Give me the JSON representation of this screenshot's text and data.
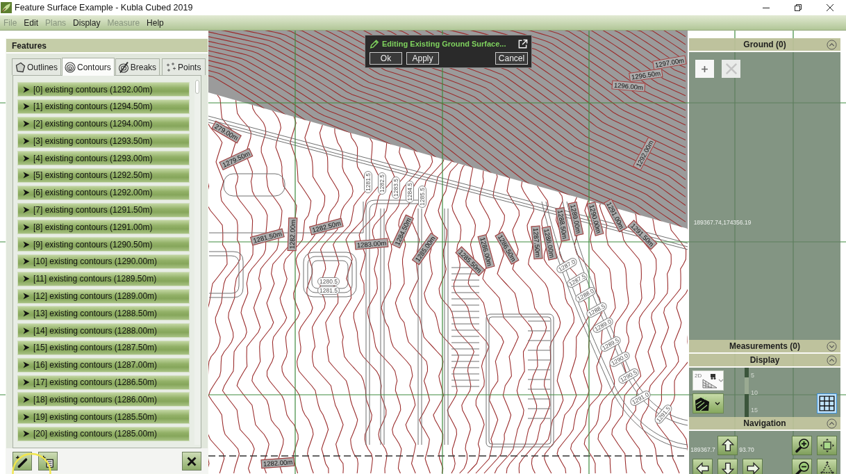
{
  "window": {
    "title": "Feature Surface Example - Kubla Cubed 2019"
  },
  "menu": [
    {
      "label": "File",
      "disabled": true
    },
    {
      "label": "Edit",
      "disabled": false
    },
    {
      "label": "Plans",
      "disabled": true
    },
    {
      "label": "Display",
      "disabled": false
    },
    {
      "label": "Measure",
      "disabled": true
    },
    {
      "label": "Help",
      "disabled": false
    }
  ],
  "features_panel": {
    "title": "Features",
    "tabs": [
      {
        "label": "Outlines",
        "kind": "outlines",
        "selected": false
      },
      {
        "label": "Contours",
        "kind": "contours",
        "selected": true
      },
      {
        "label": "Breaks",
        "kind": "breaks",
        "selected": false
      },
      {
        "label": "Points",
        "kind": "points",
        "selected": false
      }
    ],
    "items": [
      {
        "label": "[0] existing contours (1292.00m)",
        "expanded": false
      },
      {
        "label": "[1] existing contours (1294.50m)",
        "expanded": false
      },
      {
        "label": "[2] existing contours (1294.00m)",
        "expanded": false
      },
      {
        "label": "[3] existing contours (1293.50m)",
        "expanded": false
      },
      {
        "label": "[4] existing contours (1293.00m)",
        "expanded": false
      },
      {
        "label": "[5] existing contours (1292.50m)",
        "expanded": false
      },
      {
        "label": "[6] existing contours (1292.00m)",
        "expanded": false
      },
      {
        "label": "[7] existing contours (1291.50m)",
        "expanded": false
      },
      {
        "label": "[8] existing contours (1291.00m)",
        "expanded": false
      },
      {
        "label": "[9] existing contours (1290.50m)",
        "expanded": false
      },
      {
        "label": "[10] existing contours (1290.00m)",
        "expanded": false
      },
      {
        "label": "[11] existing contours (1289.50m)",
        "expanded": false
      },
      {
        "label": "[12] existing contours (1289.00m)",
        "expanded": false
      },
      {
        "label": "[13] existing contours (1288.50m)",
        "expanded": false
      },
      {
        "label": "[14] existing contours (1288.00m)",
        "expanded": false
      },
      {
        "label": "[15] existing contours (1287.50m)",
        "expanded": false
      },
      {
        "label": "[16] existing contours (1287.00m)",
        "expanded": false
      },
      {
        "label": "[17] existing contours (1286.50m)",
        "expanded": false
      },
      {
        "label": "[18] existing contours (1286.00m)",
        "expanded": false
      },
      {
        "label": "[19] existing contours (1285.50m)",
        "expanded": false
      },
      {
        "label": "[20] existing contours (1285.00m)",
        "expanded": false
      }
    ]
  },
  "edit_dialog": {
    "title": "Editing Existing Ground Surface...",
    "buttons": [
      {
        "label": "Ok"
      },
      {
        "label": "Apply"
      },
      {
        "label": "Cancel"
      }
    ]
  },
  "right_panel": {
    "sections": [
      {
        "title": "Ground (0)",
        "kind": "ground",
        "expanded": true
      },
      {
        "title": "Measurements (0)",
        "kind": "measurements",
        "expanded": false
      },
      {
        "title": "Display",
        "kind": "display",
        "expanded": true
      },
      {
        "title": "Navigation",
        "kind": "navigation",
        "expanded": true
      }
    ],
    "ground_buttons": [
      {
        "kind": "add",
        "disabled": false
      },
      {
        "kind": "delete",
        "disabled": true
      }
    ],
    "display": {
      "view_dropdown": {
        "label": "2D"
      },
      "scale": {
        "level": 0.3,
        "ticks": [
          "5",
          "10",
          "15"
        ]
      },
      "grid_toggle": {
        "on": true
      }
    }
  },
  "map": {
    "labels": [
      {
        "text": "1297.00m",
        "kind": "contour"
      },
      {
        "text": "1296.50m",
        "kind": "contour"
      },
      {
        "text": "1296.00m",
        "kind": "contour"
      },
      {
        "text": "279.00m",
        "kind": "contour"
      },
      {
        "text": "1292.00m",
        "kind": "contour"
      },
      {
        "text": "1279.50m",
        "kind": "contour"
      },
      {
        "text": "1281.5",
        "kind": "spot"
      },
      {
        "text": "1282.5",
        "kind": "spot"
      },
      {
        "text": "1283.5",
        "kind": "spot"
      },
      {
        "text": "1284.5",
        "kind": "spot"
      },
      {
        "text": "1285.5",
        "kind": "spot"
      },
      {
        "text": "1288.50m",
        "kind": "contour"
      },
      {
        "text": "1289.00m",
        "kind": "contour"
      },
      {
        "text": "1290.00m",
        "kind": "contour"
      },
      {
        "text": "1291.00m",
        "kind": "contour"
      },
      {
        "text": "1291.50m",
        "kind": "contour"
      },
      {
        "text": "1282.50m",
        "kind": "contour"
      },
      {
        "text": "1284.50m",
        "kind": "contour"
      },
      {
        "text": "1281.50m",
        "kind": "contour"
      },
      {
        "text": "1282.00m",
        "kind": "contour"
      },
      {
        "text": "1283.00m",
        "kind": "contour"
      },
      {
        "text": "1285.00m",
        "kind": "contour"
      },
      {
        "text": "1286.00m",
        "kind": "contour"
      },
      {
        "text": "1286.50m",
        "kind": "contour"
      },
      {
        "text": "1287.50m",
        "kind": "contour"
      },
      {
        "text": "1288.00m",
        "kind": "contour"
      },
      {
        "text": "1285.50m",
        "kind": "contour"
      },
      {
        "text": "1287.0",
        "kind": "spot"
      },
      {
        "text": "1287.5",
        "kind": "spot"
      },
      {
        "text": "1288.0",
        "kind": "spot"
      },
      {
        "text": "1288.5",
        "kind": "spot"
      },
      {
        "text": "1289.0",
        "kind": "spot"
      },
      {
        "text": "1289.5",
        "kind": "spot"
      },
      {
        "text": "1290.0",
        "kind": "spot"
      },
      {
        "text": "1290.5",
        "kind": "spot"
      },
      {
        "text": "1291.0",
        "kind": "spot"
      },
      {
        "text": "1291.5",
        "kind": "spot"
      },
      {
        "text": "1280.5",
        "kind": "spot"
      },
      {
        "text": "1281.5",
        "kind": "spot"
      },
      {
        "text": "1282.00m",
        "kind": "contour"
      },
      {
        "text": "189367.74,174356.19",
        "kind": "coord"
      },
      {
        "text": "189367.7",
        "kind": "coord"
      },
      {
        "text": "93.70",
        "kind": "coord"
      }
    ]
  }
}
